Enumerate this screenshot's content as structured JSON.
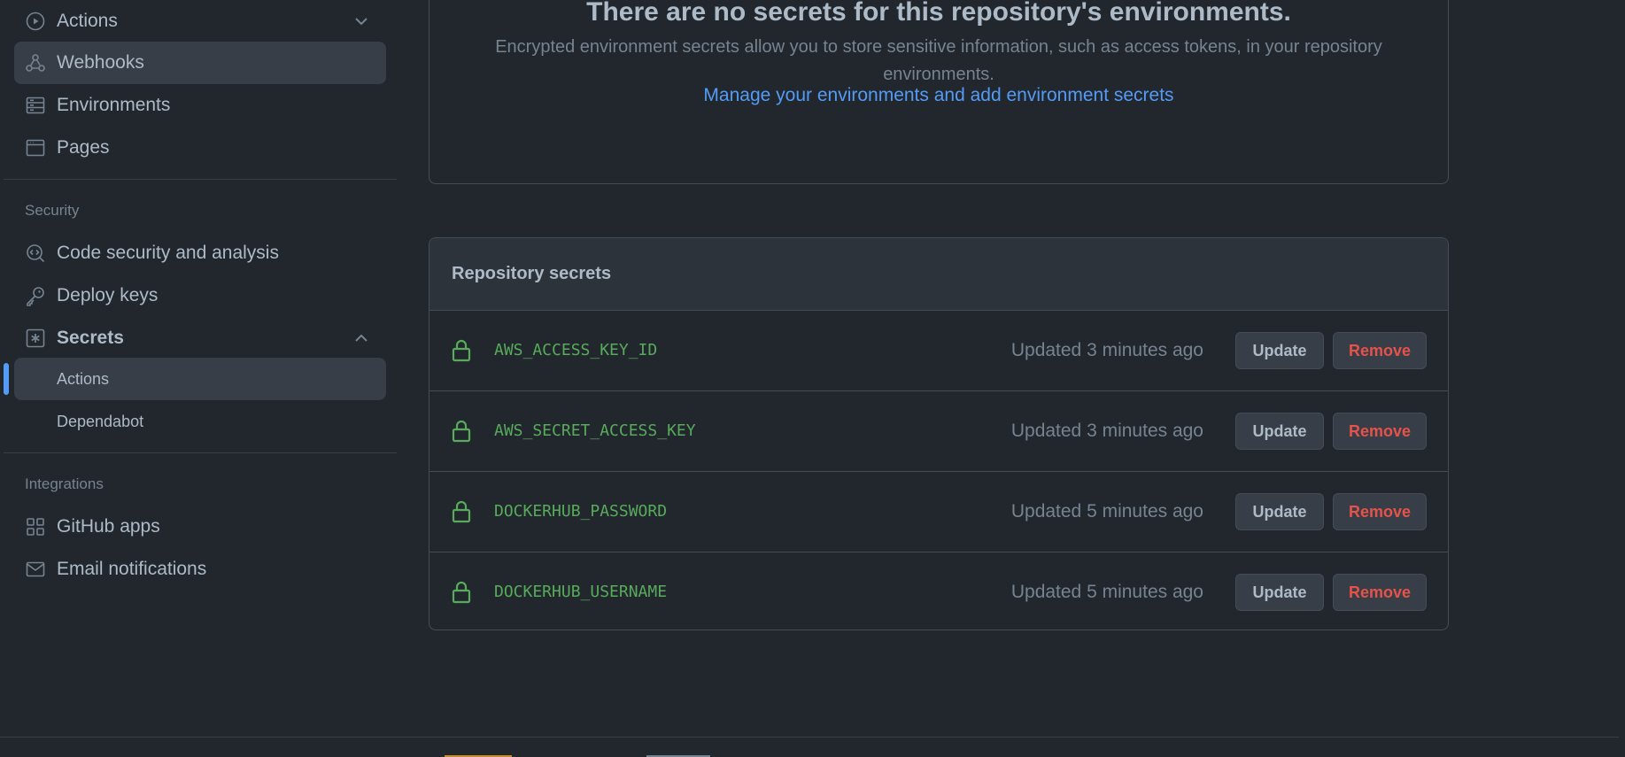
{
  "sidebar": {
    "items_top": [
      {
        "label": "Actions",
        "icon": "play-circle-icon"
      },
      {
        "label": "Webhooks",
        "icon": "webhook-icon"
      },
      {
        "label": "Environments",
        "icon": "server-icon"
      },
      {
        "label": "Pages",
        "icon": "browser-icon"
      }
    ],
    "security_title": "Security",
    "security_items": [
      {
        "label": "Code security and analysis",
        "icon": "codescan-icon"
      },
      {
        "label": "Deploy keys",
        "icon": "key-icon"
      },
      {
        "label": "Secrets",
        "icon": "asterisk-icon"
      }
    ],
    "secrets_sub": [
      {
        "label": "Actions"
      },
      {
        "label": "Dependabot"
      }
    ],
    "integrations_title": "Integrations",
    "integrations_items": [
      {
        "label": "GitHub apps",
        "icon": "apps-icon"
      },
      {
        "label": "Email notifications",
        "icon": "mail-icon"
      }
    ]
  },
  "environments": {
    "title": "There are no secrets for this repository's environments.",
    "description": "Encrypted environment secrets allow you to store sensitive information, such as access tokens, in your repository environments.",
    "link": "Manage your environments and add environment secrets"
  },
  "repository_secrets": {
    "header": "Repository secrets",
    "update_label": "Update",
    "remove_label": "Remove",
    "rows": [
      {
        "name": "AWS_ACCESS_KEY_ID",
        "updated": "Updated 3 minutes ago"
      },
      {
        "name": "AWS_SECRET_ACCESS_KEY",
        "updated": "Updated 3 minutes ago"
      },
      {
        "name": "DOCKERHUB_PASSWORD",
        "updated": "Updated 5 minutes ago"
      },
      {
        "name": "DOCKERHUB_USERNAME",
        "updated": "Updated 5 minutes ago"
      }
    ]
  },
  "colors": {
    "background": "#22272e",
    "accent": "#539bf5",
    "success": "#57ab5a",
    "danger": "#e5534b"
  }
}
